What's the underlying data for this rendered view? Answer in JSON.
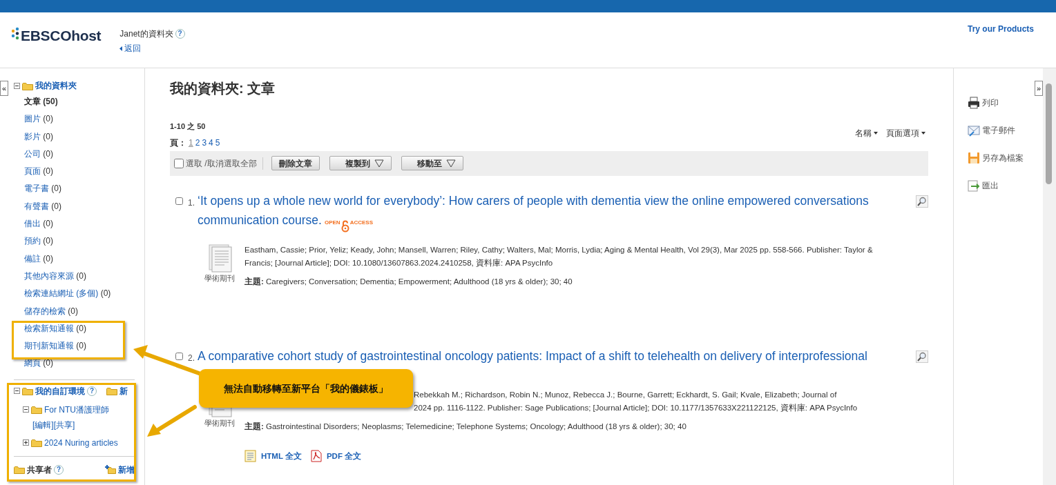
{
  "header": {
    "logo": "EBSCOhost",
    "folder_title": "Janet的資料夾",
    "help": "?",
    "back_link": "返回",
    "top_link": "Try our Products"
  },
  "sidebar": {
    "collapse_button": "«",
    "folder": {
      "label": "我的資料夾",
      "expanded": true,
      "items": [
        {
          "label": "文章",
          "count": "(50)",
          "selected": true
        },
        {
          "label": "圖片",
          "count": "(0)",
          "selected": false
        },
        {
          "label": "影片",
          "count": "(0)",
          "selected": false
        },
        {
          "label": "公司",
          "count": "(0)",
          "selected": false
        },
        {
          "label": "頁面",
          "count": "(0)",
          "selected": false
        },
        {
          "label": "電子書",
          "count": "(0)",
          "selected": false
        },
        {
          "label": "有聲書",
          "count": "(0)",
          "selected": false
        },
        {
          "label": "借出",
          "count": "(0)",
          "selected": false
        },
        {
          "label": "預約",
          "count": "(0)",
          "selected": false
        },
        {
          "label": "備註",
          "count": "(0)",
          "selected": false
        },
        {
          "label": "其他內容來源",
          "count": "(0)",
          "selected": false
        },
        {
          "label": "檢索連結網址 (多個)",
          "count": "(0)",
          "selected": false
        },
        {
          "label": "儲存的檢索",
          "count": "(0)",
          "selected": false
        },
        {
          "label": "檢索新知通報",
          "count": "(0)",
          "selected": false
        },
        {
          "label": "期刊新知通報",
          "count": "(0)",
          "selected": false
        },
        {
          "label": "網頁",
          "count": "(0)",
          "selected": false
        }
      ]
    },
    "custom": {
      "label": "我的自訂環境",
      "help": "?",
      "new_label": "新",
      "expanded": true,
      "children": [
        {
          "label": "For NTU潘護理師",
          "expanded": true,
          "actions": [
            "[編輯]",
            "[共享]"
          ]
        },
        {
          "label": "2024 Nuring articles",
          "expanded": false
        }
      ]
    },
    "shared": {
      "label": "共享者",
      "help": "?",
      "add_label": "新增"
    }
  },
  "main": {
    "title": "我的資料夾: 文章",
    "range": "1-10 之 50",
    "page_label": "頁：",
    "pages": [
      {
        "label": "1",
        "selected": true
      },
      {
        "label": "2",
        "selected": false
      },
      {
        "label": "3",
        "selected": false
      },
      {
        "label": "4",
        "selected": false
      },
      {
        "label": "5",
        "selected": false
      }
    ],
    "sort": "名稱",
    "page_options": "頁面選項",
    "toolbar": {
      "select_all": "選取 /取消選取全部",
      "checked": false,
      "buttons": [
        {
          "label": "刪除文章",
          "dropdown": false
        },
        {
          "label": "複製到",
          "dropdown": true
        },
        {
          "label": "移動至",
          "dropdown": true
        }
      ]
    },
    "results": [
      {
        "number": "1.",
        "checked": false,
        "title": "‘It opens up a whole new world for everybody’: How carers of people with dementia view the online empowered conversations communication course.",
        "open_access": {
          "left": "OPEN",
          "right": "ACCESS"
        },
        "covered": false,
        "type_label": "學術期刊",
        "details": [
          "Eastham, Cassie; Prior, Yeliz; Keady, John; Mansell, Warren; Riley, Cathy; Walters, Mal; Morris, Lydia; Aging & Mental Health, Vol 29(3), Mar 2025 pp. 558-566. Publisher: Taylor & Francis; [Journal Article]; DOI: 10.1080/13607863.2024.2410258, 資料庫: APA PsycInfo"
        ],
        "subjects_label": "主題:",
        "subjects": "Caregivers; Conversation; Dementia; Empowerment; Adulthood (18 yrs & older); 30; 40"
      },
      {
        "number": "2.",
        "checked": false,
        "title": "A comparative cohort study of gastrointestinal oncology patients: Impact of a shift to telehealth on delivery of interprofessional",
        "covered": true,
        "type_label": "學術期刊",
        "details": [
          "Rebekkah M.; Richardson, Robin N.; Munoz, Rebecca J.; Bourne, Garrett; Eckhardt, S. Gail; Kvale, Elizabeth; Journal of",
          "2024 pp. 1116-1122. Publisher: Sage Publications; [Journal Article]; DOI: 10.1177/1357633X221122125, 資料庫: APA PsycInfo"
        ],
        "subjects_label": "主題:",
        "subjects": "Gastrointestinal Disorders; Neoplasms; Telemedicine; Telephone Systems; Oncology; Adulthood (18 yrs & older); 30; 40",
        "links": [
          {
            "kind": "html",
            "label": "HTML 全文"
          },
          {
            "kind": "pdf",
            "label": "PDF 全文"
          }
        ]
      }
    ]
  },
  "tools": {
    "expand_button": "»",
    "actions": [
      {
        "kind": "print",
        "label": "列印"
      },
      {
        "kind": "email",
        "label": "電子郵件"
      },
      {
        "kind": "save",
        "label": "另存為檔案"
      },
      {
        "kind": "export",
        "label": "匯出"
      }
    ]
  },
  "annotation": {
    "callout": "無法自動移轉至新平台「我的儀錶板」"
  }
}
